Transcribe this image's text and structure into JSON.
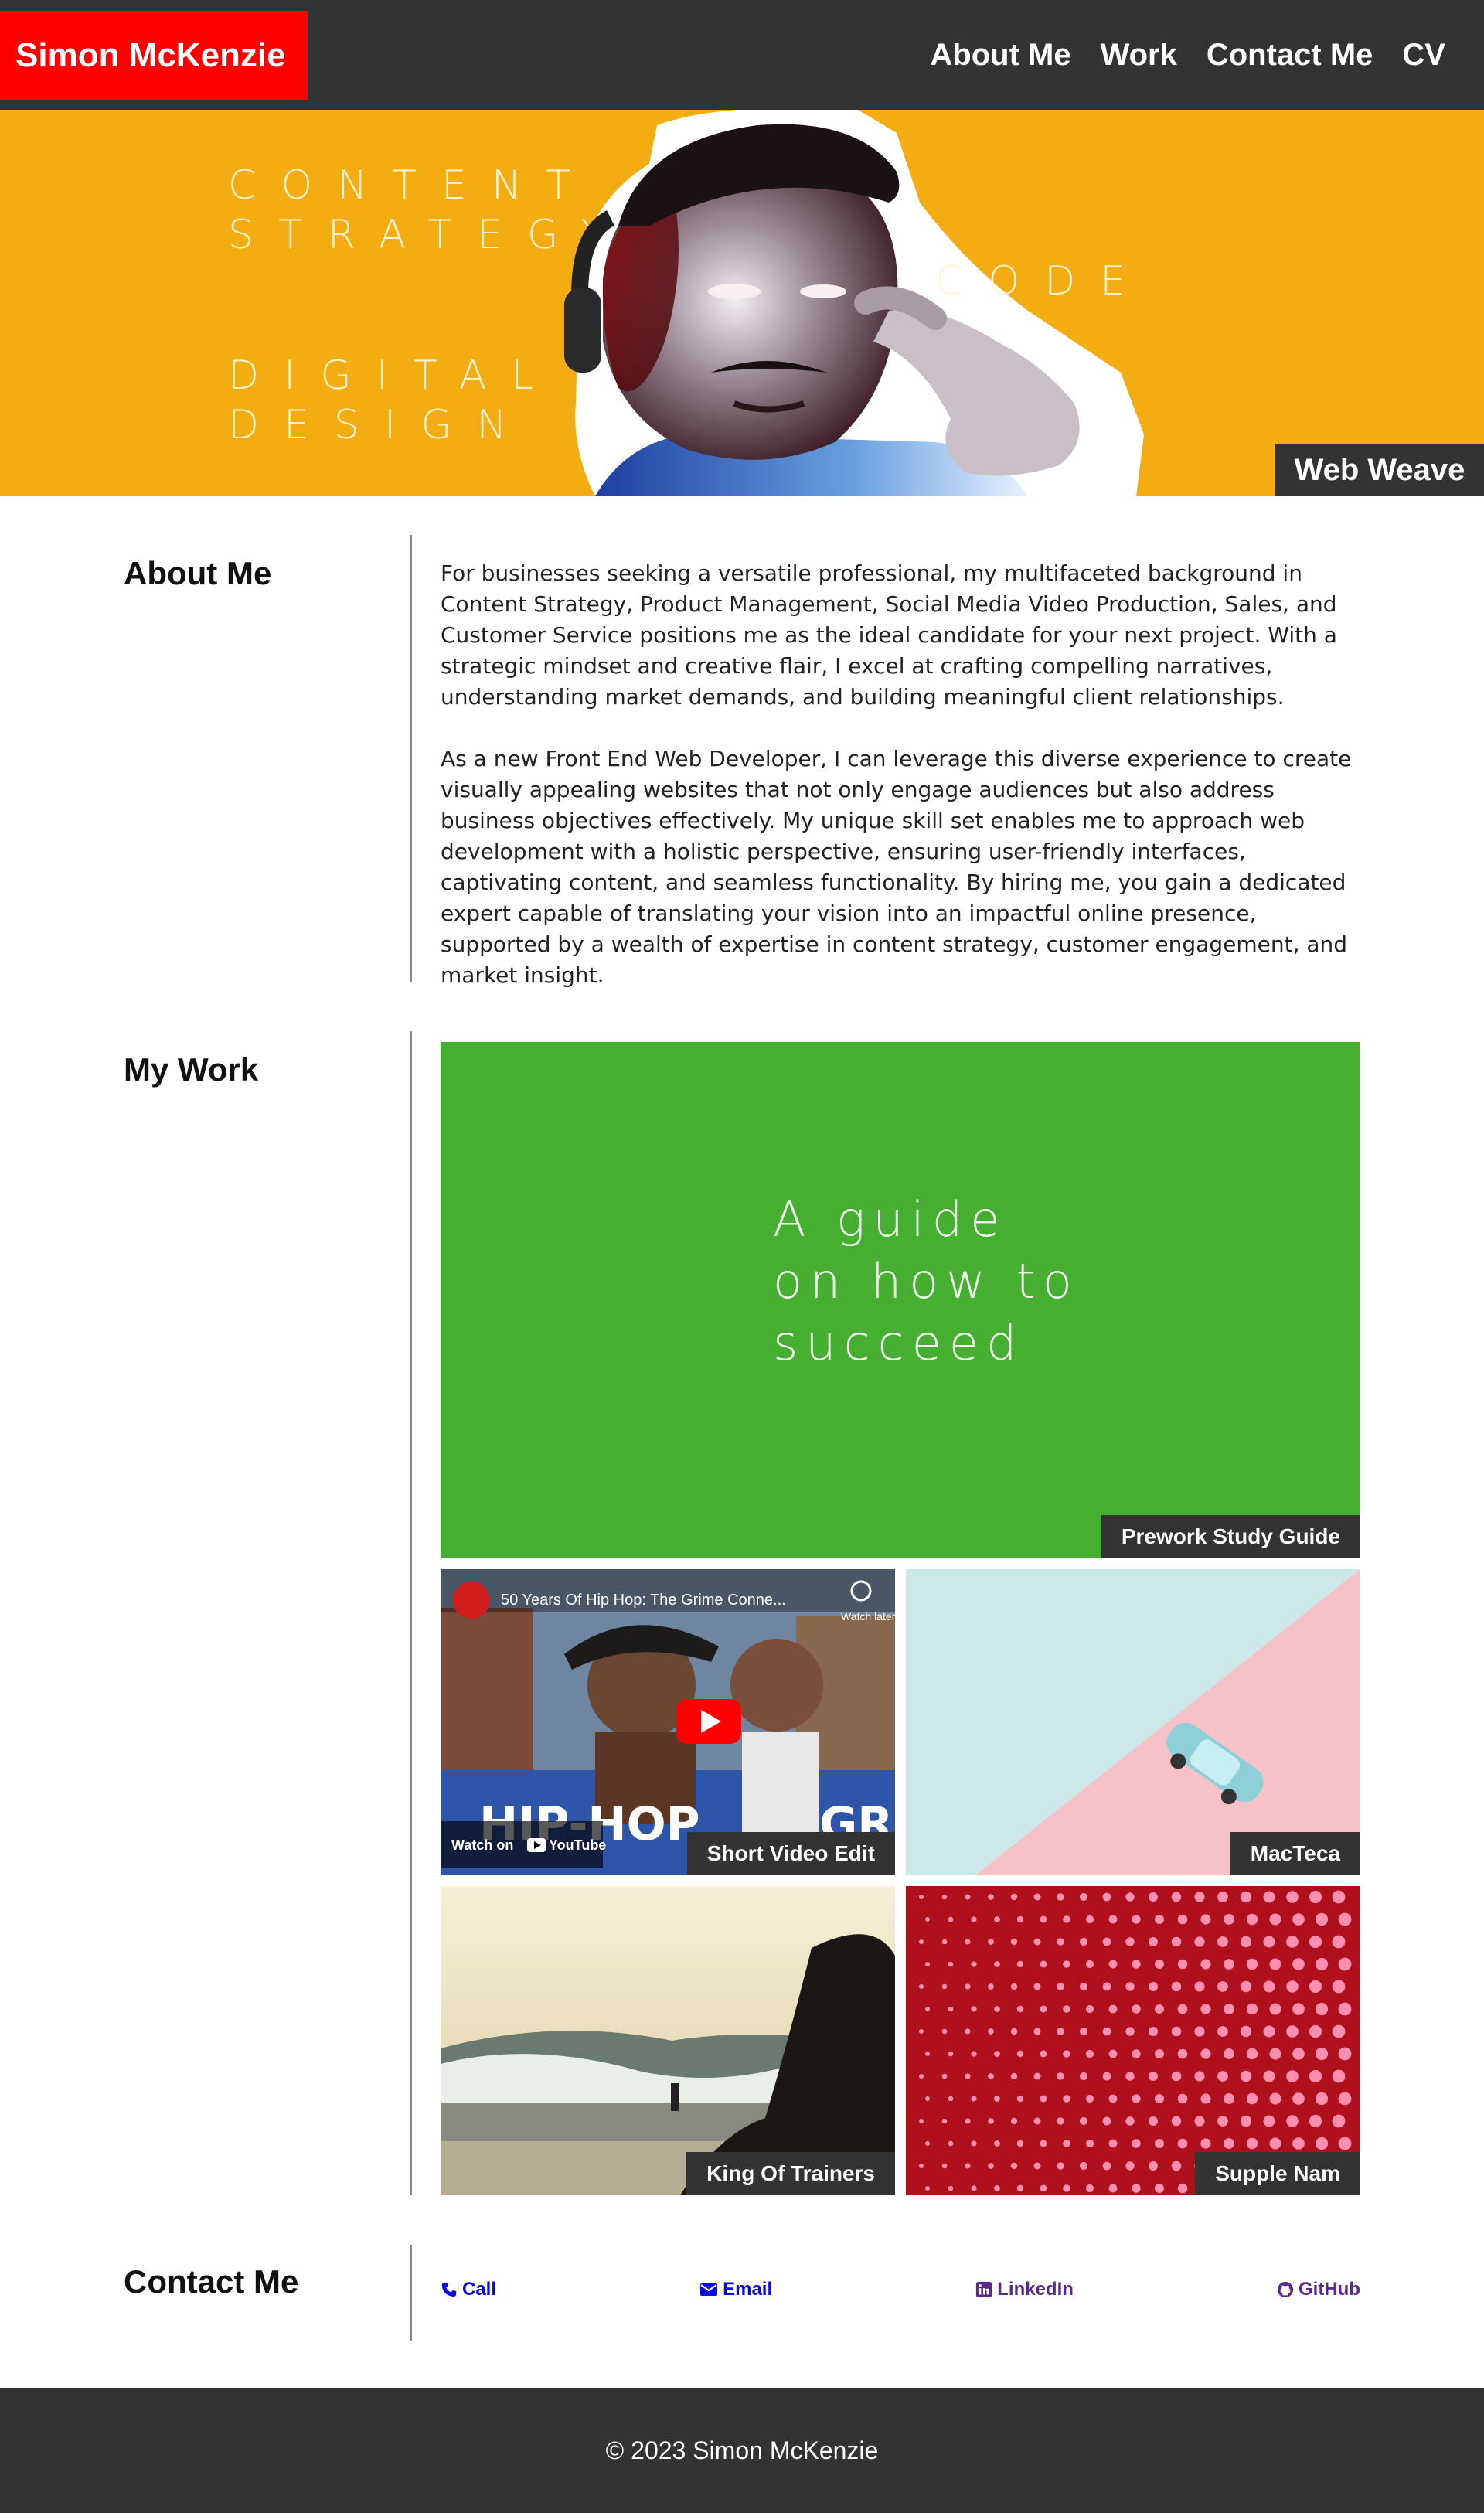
{
  "header": {
    "brand": "Simon McKenzie",
    "nav": [
      {
        "label": "About Me"
      },
      {
        "label": "Work"
      },
      {
        "label": "Contact Me"
      },
      {
        "label": "CV"
      }
    ]
  },
  "hero": {
    "words": [
      "CONTENT",
      "STRATEGY",
      "DIGITAL",
      "DESIGN",
      "CODE"
    ],
    "badge": "Web Weave"
  },
  "about": {
    "title": "About Me",
    "paragraphs": [
      "For businesses seeking a versatile professional, my multifaceted background in Content Strategy, Product Management, Social Media Video Production, Sales, and Customer Service positions me as the ideal candidate for your next project. With a strategic mindset and creative flair, I excel at crafting compelling narratives, understanding market demands, and building meaningful client relationships.",
      "As a new Front End Web Developer, I can leverage this diverse experience to create visually appealing websites that not only engage audiences but also address business objectives effectively. My unique skill set enables me to approach web development with a holistic perspective, ensuring user-friendly interfaces, captivating content, and seamless functionality. By hiring me, you gain a dedicated expert capable of translating your vision into an impactful online presence, supported by a wealth of expertise in content strategy, customer engagement, and market insight."
    ]
  },
  "work": {
    "title": "My Work",
    "featured": {
      "image_text": [
        "A guide",
        "on how to",
        "succeed"
      ],
      "label": "Prework Study Guide"
    },
    "video": {
      "title": "50 Years Of Hip Hop: The Grime Conne...",
      "watch_later": "Watch later",
      "watch_on": "Watch on",
      "youtube": "YouTube",
      "left_word": "HIP-HOP",
      "right_word": "GRIM",
      "label": "Short Video Edit"
    },
    "tiles": [
      {
        "label": "MacTeca"
      },
      {
        "label": "King Of Trainers"
      },
      {
        "label": "Supple Nam"
      }
    ]
  },
  "contact": {
    "title": "Contact Me",
    "links": [
      {
        "label": "Call",
        "icon": "phone-icon",
        "color": "#0a0ae0"
      },
      {
        "label": "Email",
        "icon": "envelope-icon",
        "color": "#0a0ae0"
      },
      {
        "label": "LinkedIn",
        "icon": "linkedin-icon",
        "color": "#5a2a8a"
      },
      {
        "label": "GitHub",
        "icon": "github-icon",
        "color": "#5a2a8a"
      }
    ]
  },
  "footer": {
    "copyright": "© 2023 Simon McKenzie"
  },
  "colors": {
    "header_bg": "#333333",
    "brand_bg": "#ff0000",
    "hero_bg": "#f3ad13",
    "featured_bg": "#46af31"
  }
}
